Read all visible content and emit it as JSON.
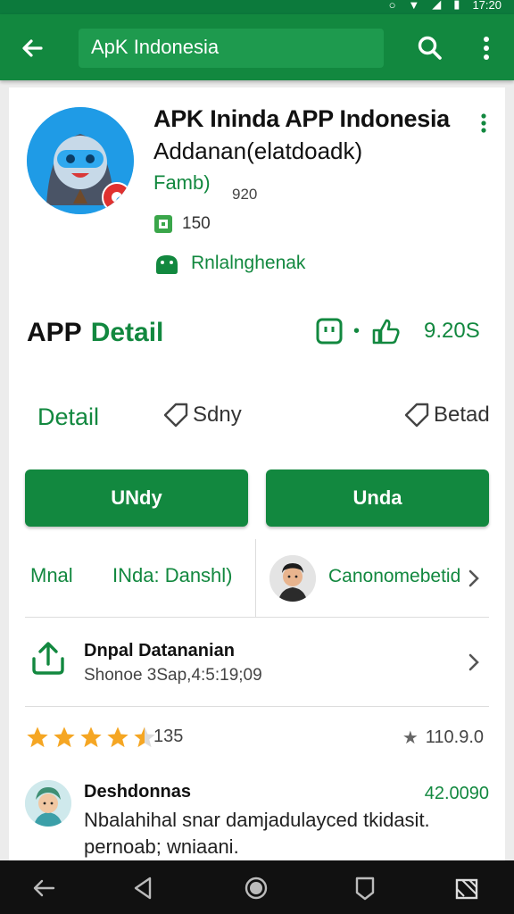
{
  "status": {
    "time": "17:20"
  },
  "appbar": {
    "title": "ApK Indonesia"
  },
  "app": {
    "name": "APK Ininda APP Indonesia",
    "subtitle": "Addanan(elatdoadk)",
    "family": "Famb)",
    "count": "920",
    "rating_count": "150",
    "publisher": "Rnlalnghenak"
  },
  "section": {
    "title_app": "APP",
    "title_detail": "Detail",
    "value": "9.20S"
  },
  "tabs": {
    "detail": "Detail",
    "share": "Sdny",
    "betad": "Betad"
  },
  "buttons": {
    "primary": "UNdy",
    "secondary": "Unda"
  },
  "info": {
    "label1": "Mnal",
    "label2": "INda: Danshl)",
    "developer": "Canonomebetid"
  },
  "update": {
    "title": "Dnpal Datananian",
    "subtitle": "Shonoe 3Sap,4:5:19;09"
  },
  "ratings": {
    "count": "135",
    "score": "110.9.0"
  },
  "review": {
    "name": "Deshdonnas",
    "number": "42.0090",
    "text": "Nbalahihal snar damjadulayced tkidasit. pernoab; wniaani."
  },
  "colors": {
    "brand": "#12883f",
    "brand_dark": "#0c7a3c",
    "star": "#f5a623"
  }
}
